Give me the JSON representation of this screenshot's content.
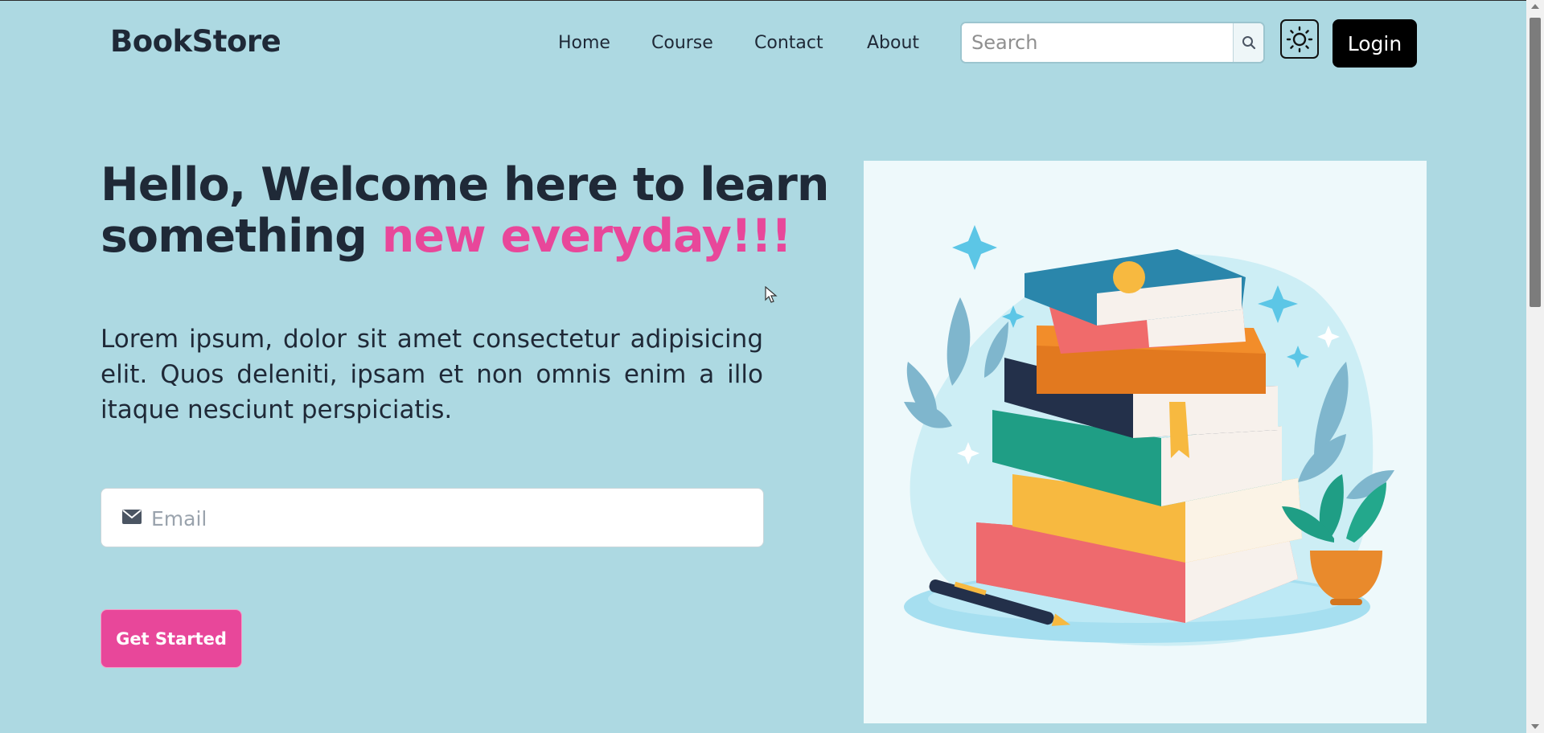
{
  "header": {
    "logo": "BookStore",
    "nav": [
      "Home",
      "Course",
      "Contact",
      "About"
    ],
    "search": {
      "placeholder": "Search",
      "icon": "search-icon"
    },
    "theme_toggle_icon": "sun-icon",
    "login_label": "Login"
  },
  "hero": {
    "headline_line1": "Hello, Welcome here to learn",
    "headline_line2_prefix": "something",
    "headline_accent": "new everyday!!!",
    "description": "Lorem ipsum, dolor sit amet consectetur adipisicing elit. Quos deleniti, ipsam et non omnis enim a illo itaque nesciunt perspiciatis.",
    "email": {
      "placeholder": "Email",
      "icon": "envelope-icon"
    },
    "cta_label": "Get Started",
    "illustration": "books-stack-illustration"
  },
  "colors": {
    "background": "#add9e2",
    "accent": "#e8479a",
    "text": "#1f2937",
    "login_bg": "#000000"
  }
}
